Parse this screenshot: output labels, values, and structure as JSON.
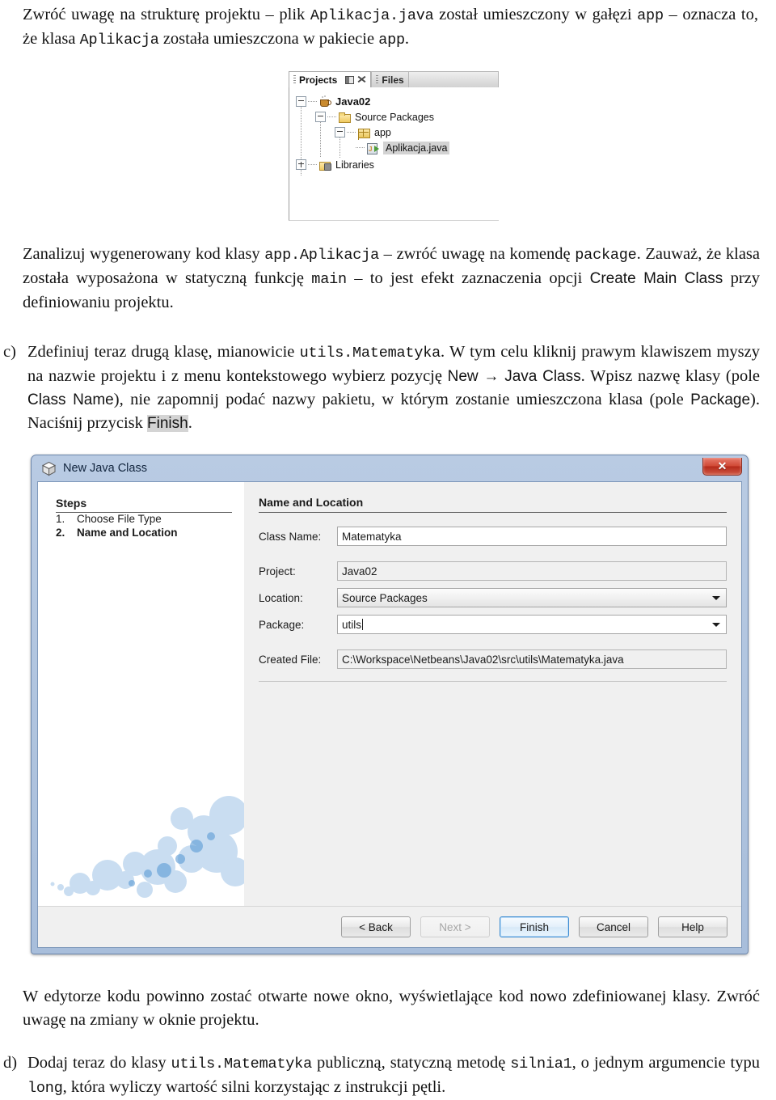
{
  "paragraphs": {
    "intro": {
      "s1": "Zwróć uwagę na strukturę projektu – plik ",
      "code1": "Aplikacja.java",
      "s2": " został umieszczony w gałęzi ",
      "code2": "app",
      "s3": " – oznacza to, że klasa ",
      "code3": "Aplikacja",
      "s4": " została umieszczona w pakiecie ",
      "code4": "app",
      "s5": "."
    },
    "analyze": {
      "s1": "Zanalizuj wygenerowany kod klasy ",
      "code1": "app.Aplikacja",
      "s2": " – zwróć uwagę na komendę ",
      "code2": "package",
      "s3": ". Zauważ, że klasa została wyposażona w statyczną funkcję ",
      "code3": "main",
      "s4": " – to jest efekt zaznaczenia opcji ",
      "ui1": "Create Main Class",
      "s5": " przy definiowaniu projektu."
    },
    "item_c": {
      "marker": "c)",
      "s1": "Zdefiniuj teraz drugą klasę, mianowicie ",
      "code1": "utils.Matematyka",
      "s2": ". W tym celu kliknij prawym klawiszem myszy na nazwie projektu i z menu kontekstowego wybierz pozycję ",
      "ui1": "New",
      "s3": " → ",
      "ui2": "Java Class",
      "s4": ". Wpisz nazwę klasy (pole ",
      "ui3": "Class Name",
      "s5": "), nie zapomnij podać nazwy pakietu, w którym zostanie umieszczona klasa (pole ",
      "ui4": "Package",
      "s6": "). Naciśnij przycisk ",
      "ui5": "Finish",
      "s7": "."
    },
    "editor": {
      "s1": "W edytorze kodu powinno zostać otwarte nowe okno, wyświetlające kod nowo zdefiniowanej klasy. Zwróć uwagę na zmiany w oknie projektu."
    },
    "item_d": {
      "marker": "d)",
      "s1": "Dodaj teraz do klasy ",
      "code1": "utils.Matematyka",
      "s2": " publiczną, statyczną metodę ",
      "code2": "silnia1",
      "s3": ", o jednym argumencie typu ",
      "code3": "long",
      "s4": ", która wyliczy wartość silni korzystając z instrukcji pętli."
    }
  },
  "project_tree": {
    "tabs": [
      {
        "label": "Projects",
        "active": true
      },
      {
        "label": "Files",
        "active": false
      }
    ],
    "nodes": [
      {
        "label": "Java02",
        "icon": "java-project-icon",
        "toggle": "minus",
        "selected": false
      },
      {
        "label": "Source Packages",
        "icon": "source-folder-icon",
        "toggle": "minus",
        "selected": false
      },
      {
        "label": "app",
        "icon": "package-icon",
        "toggle": "minus",
        "selected": false
      },
      {
        "label": "Aplikacja.java",
        "icon": "java-file-icon",
        "toggle": "none",
        "selected": true
      },
      {
        "label": "Libraries",
        "icon": "libraries-icon",
        "toggle": "plus",
        "selected": false
      }
    ]
  },
  "dialog": {
    "title": "New Java Class",
    "close_label": "✕",
    "steps_heading": "Steps",
    "steps": [
      {
        "num": "1.",
        "label": "Choose File Type",
        "current": false
      },
      {
        "num": "2.",
        "label": "Name and Location",
        "current": true
      }
    ],
    "form_heading": "Name and Location",
    "fields": [
      {
        "label": "Class Name:",
        "value": "Matematyka",
        "type": "text"
      },
      {
        "label": "Project:",
        "value": "Java02",
        "type": "readonly"
      },
      {
        "label": "Location:",
        "value": "Source Packages",
        "type": "combo"
      },
      {
        "label": "Package:",
        "value": "utils",
        "type": "editable-combo"
      },
      {
        "label": "Created File:",
        "value": "C:\\Workspace\\Netbeans\\Java02\\src\\utils\\Matematyka.java",
        "type": "readonly"
      }
    ],
    "buttons": [
      {
        "label": "< Back",
        "state": "normal"
      },
      {
        "label": "Next >",
        "state": "disabled"
      },
      {
        "label": "Finish",
        "state": "default"
      },
      {
        "label": "Cancel",
        "state": "normal"
      },
      {
        "label": "Help",
        "state": "normal"
      }
    ]
  },
  "colors": {
    "dialog_titlebar": "#b9cbe3",
    "dialog_border": "#6d87ab",
    "close_button": "#c0392b",
    "default_button_border": "#3c8bd1",
    "tree_selection": "#d3d3d3",
    "folder_icon": "#efc95f"
  }
}
